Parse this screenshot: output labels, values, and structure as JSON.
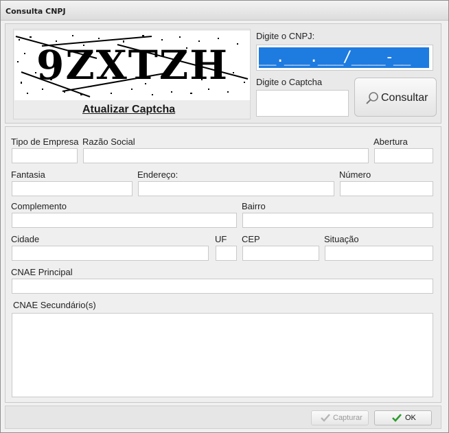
{
  "window": {
    "title": "Consulta CNPJ"
  },
  "captcha": {
    "image_text": "9ZXTZH",
    "refresh_link": "Atualizar Captcha"
  },
  "cnpj": {
    "label": "Digite o CNPJ:",
    "mask_value": "__.___.___/____-__"
  },
  "captcha_field": {
    "label": "Digite o Captcha",
    "value": ""
  },
  "consultar_button": {
    "label": "Consultar",
    "icon": "search-icon"
  },
  "form": {
    "tipo_empresa": {
      "label": "Tipo de Empresa",
      "value": ""
    },
    "razao_social": {
      "label": "Razão Social",
      "value": ""
    },
    "abertura": {
      "label": "Abertura",
      "value": ""
    },
    "fantasia": {
      "label": "Fantasia",
      "value": ""
    },
    "endereco": {
      "label": "Endereço:",
      "value": ""
    },
    "numero": {
      "label": "Número",
      "value": ""
    },
    "complemento": {
      "label": "Complemento",
      "value": ""
    },
    "bairro": {
      "label": "Bairro",
      "value": ""
    },
    "cidade": {
      "label": "Cidade",
      "value": ""
    },
    "uf": {
      "label": "UF",
      "value": ""
    },
    "cep": {
      "label": "CEP",
      "value": ""
    },
    "situacao": {
      "label": "Situação",
      "value": ""
    },
    "cnae_principal": {
      "label": "CNAE Principal",
      "value": ""
    },
    "cnae_secundario": {
      "label": "CNAE Secundário(s)",
      "value": ""
    }
  },
  "footer": {
    "capturar_label": "Capturar",
    "capturar_icon": "check-icon",
    "ok_label": "OK",
    "ok_icon": "check-icon",
    "ok_icon_color": "#2e9b2e"
  }
}
